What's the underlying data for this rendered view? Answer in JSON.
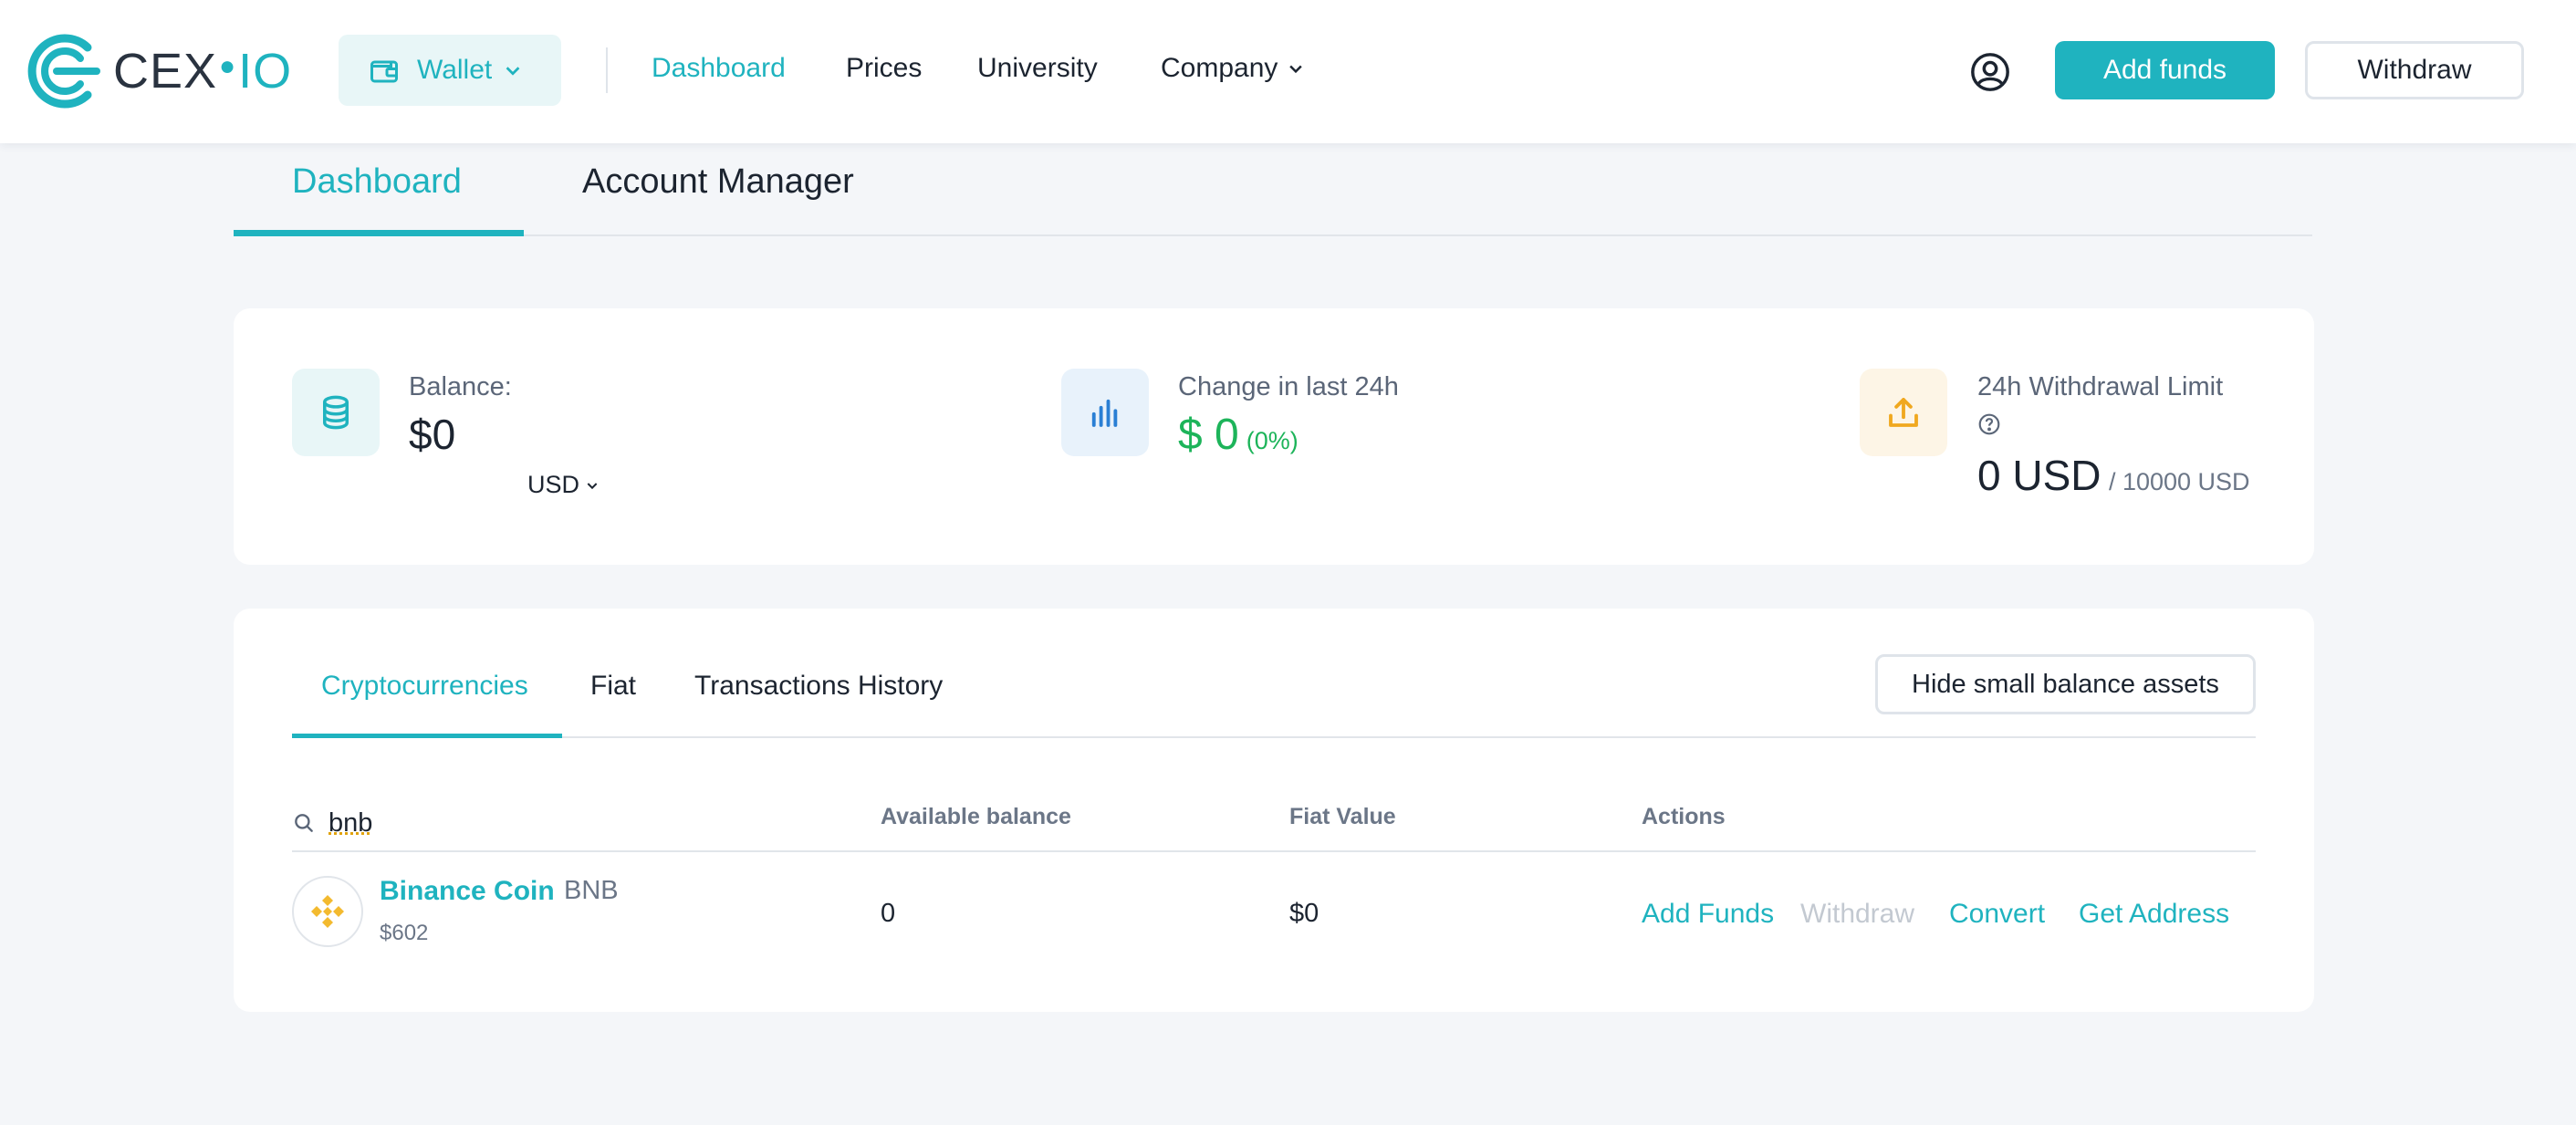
{
  "header": {
    "logo": {
      "text_main": "CEX",
      "text_suffix": "IO"
    },
    "wallet_label": "Wallet",
    "nav": [
      {
        "label": "Dashboard",
        "active": true
      },
      {
        "label": "Prices"
      },
      {
        "label": "University"
      },
      {
        "label": "Company"
      }
    ],
    "add_funds_label": "Add funds",
    "withdraw_label": "Withdraw"
  },
  "page_tabs": [
    {
      "label": "Dashboard",
      "active": true
    },
    {
      "label": "Account Manager"
    }
  ],
  "summary": {
    "balance": {
      "label": "Balance:",
      "value": "$0",
      "currency": "USD"
    },
    "change": {
      "label": "Change in last 24h",
      "value": "$ 0",
      "percent": "(0%)"
    },
    "withdrawal_limit": {
      "label": "24h Withdrawal Limit",
      "value": "0 USD",
      "limit": "/ 10000 USD"
    }
  },
  "assets": {
    "tabs": [
      {
        "label": "Cryptocurrencies",
        "active": true
      },
      {
        "label": "Fiat"
      },
      {
        "label": "Transactions History"
      }
    ],
    "hide_small_label": "Hide small balance assets",
    "search_value": "bnb",
    "columns": {
      "available_balance": "Available balance",
      "fiat_value": "Fiat Value",
      "actions": "Actions"
    },
    "rows": [
      {
        "name": "Binance Coin",
        "symbol": "BNB",
        "price": "$602",
        "available_balance": "0",
        "fiat_value": "$0",
        "actions": [
          {
            "label": "Add Funds",
            "enabled": true
          },
          {
            "label": "Withdraw",
            "enabled": false
          },
          {
            "label": "Convert",
            "enabled": true
          },
          {
            "label": "Get Address",
            "enabled": true
          }
        ]
      }
    ]
  },
  "colors": {
    "accent": "#1fb3bf",
    "positive": "#1db45a",
    "disabled": "#c3c9d1",
    "binance": "#f3ba2f"
  },
  "icons": {
    "wallet": "wallet-icon",
    "user": "user-circle-icon",
    "balance": "coins-stack-icon",
    "change": "bar-chart-icon",
    "limit": "upload-icon",
    "help": "question-circle-icon",
    "search": "search-icon",
    "coin": "binance-coin-icon"
  }
}
